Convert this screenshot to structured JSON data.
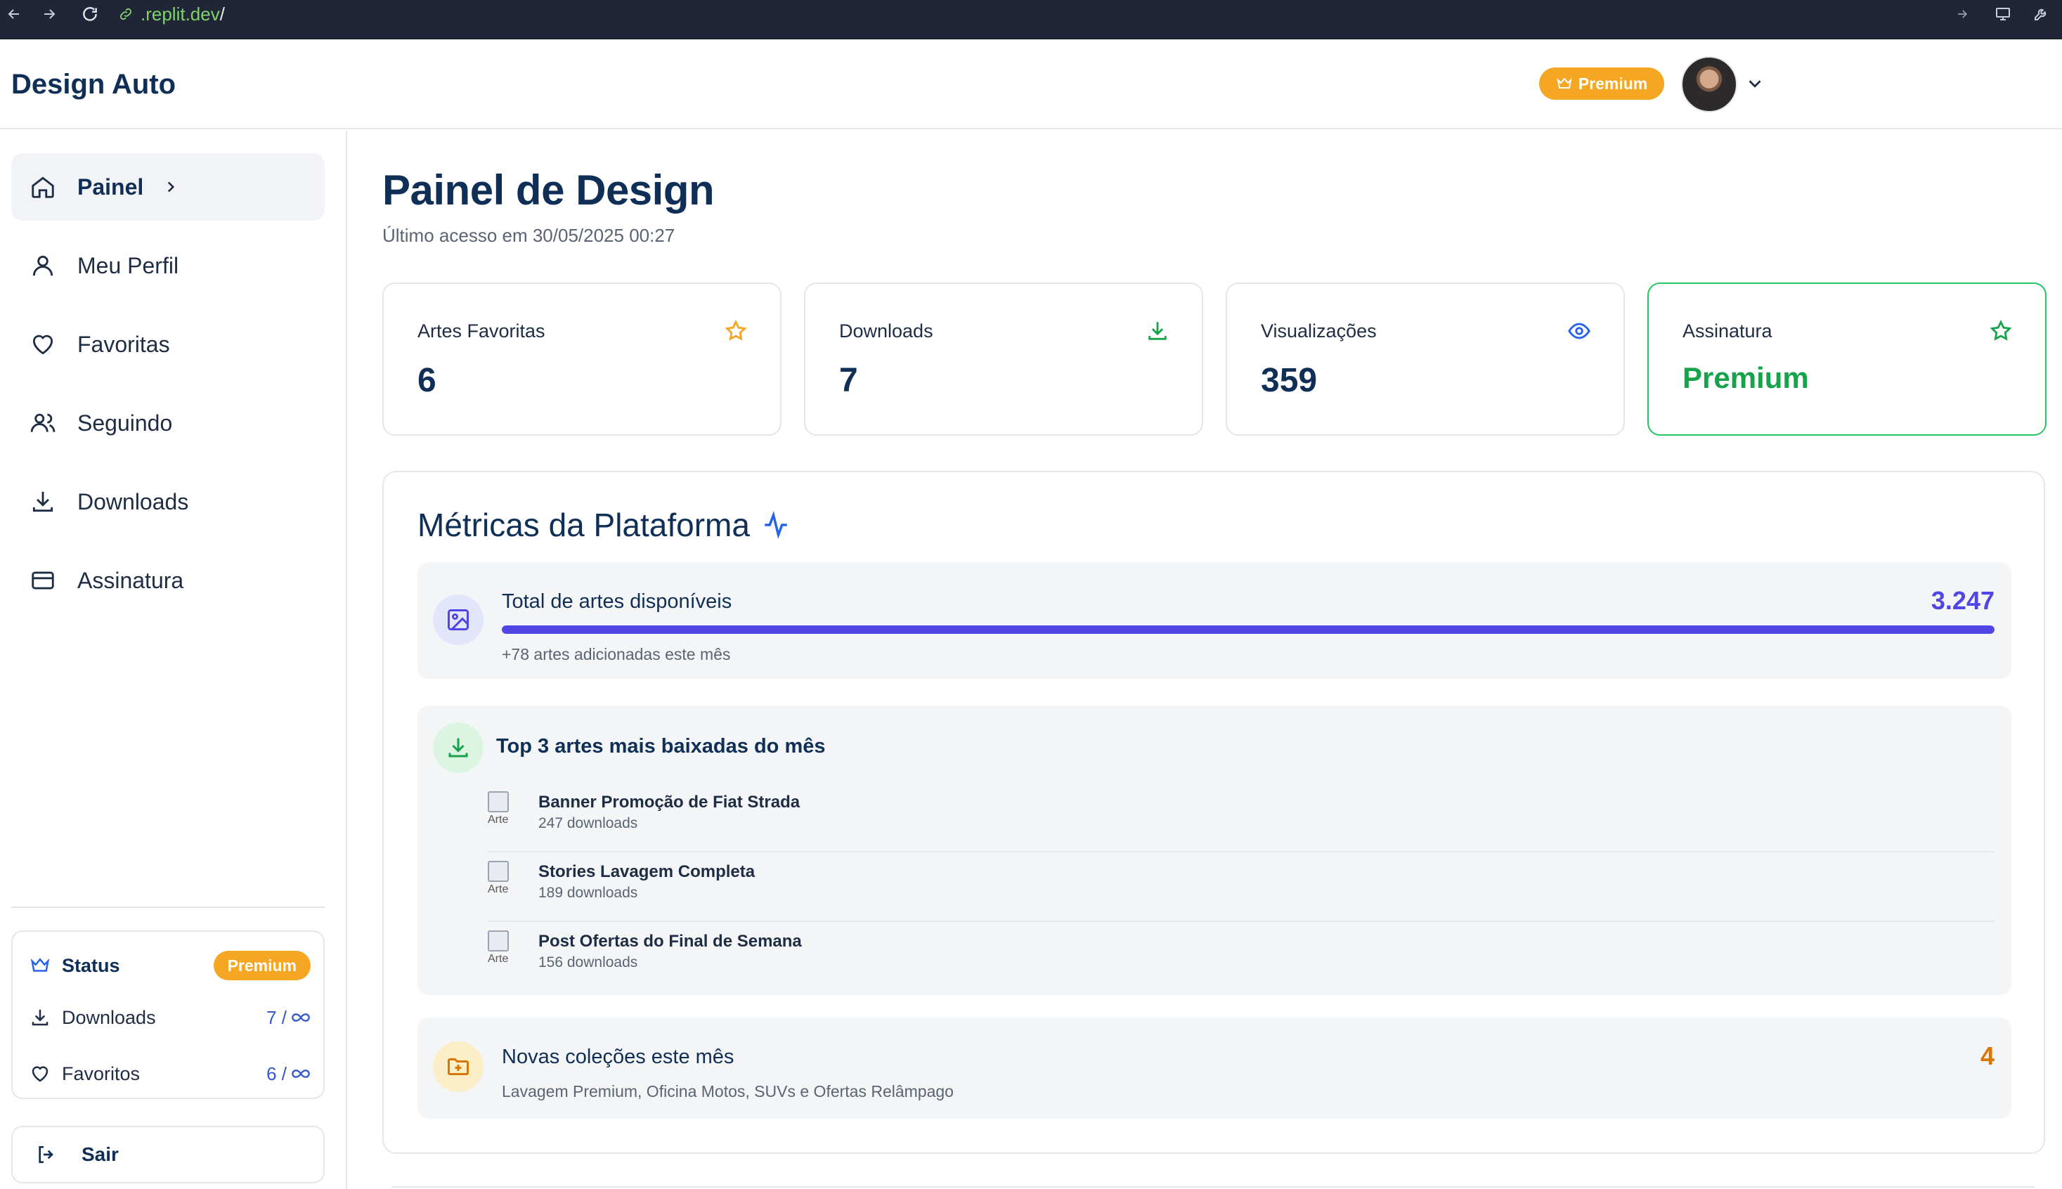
{
  "browser": {
    "url_host": ".replit.dev",
    "url_path": "/"
  },
  "header": {
    "brand": "Design Auto",
    "premium_label": "Premium"
  },
  "sidebar": {
    "items": [
      {
        "label": "Painel",
        "icon": "home-icon",
        "active": true
      },
      {
        "label": "Meu Perfil",
        "icon": "user-icon"
      },
      {
        "label": "Favoritas",
        "icon": "heart-icon"
      },
      {
        "label": "Seguindo",
        "icon": "users-icon"
      },
      {
        "label": "Downloads",
        "icon": "download-icon"
      },
      {
        "label": "Assinatura",
        "icon": "credit-card-icon"
      }
    ],
    "status": {
      "title": "Status",
      "badge": "Premium",
      "downloads_label": "Downloads",
      "downloads_value": "7 /",
      "favorites_label": "Favoritos",
      "favorites_value": "6 /"
    },
    "logout_label": "Sair"
  },
  "main": {
    "title": "Painel de Design",
    "subtitle": "Último acesso em 30/05/2025 00:27",
    "stats": [
      {
        "label": "Artes Favoritas",
        "value": "6",
        "icon": "star-icon",
        "color": "#f5a623"
      },
      {
        "label": "Downloads",
        "value": "7",
        "icon": "download-icon",
        "color": "#16a34a"
      },
      {
        "label": "Visualizações",
        "value": "359",
        "icon": "eye-icon",
        "color": "#2563eb"
      },
      {
        "label": "Assinatura",
        "value": "Premium",
        "icon": "star-icon",
        "color": "#16a34a"
      }
    ],
    "metrics": {
      "title": "Métricas da Plataforma",
      "total": {
        "label": "Total de artes disponíveis",
        "value": "3.247",
        "progress": 1.0,
        "note": "+78 artes adicionadas este mês"
      },
      "top": {
        "label": "Top 3 artes mais baixadas do mês",
        "thumb_alt": "Arte",
        "items": [
          {
            "title": "Banner Promoção de Fiat Strada",
            "downloads": "247 downloads"
          },
          {
            "title": "Stories Lavagem Completa",
            "downloads": "189 downloads"
          },
          {
            "title": "Post Ofertas do Final de Semana",
            "downloads": "156 downloads"
          }
        ]
      },
      "collections": {
        "label": "Novas coleções este mês",
        "value": "4",
        "note": "Lavagem Premium, Oficina Motos, SUVs e Ofertas Relâmpago"
      }
    }
  },
  "colors": {
    "accent": "#4f46e5",
    "premium": "#f5a623",
    "success": "#16a34a",
    "brand": "#0f2f57"
  }
}
